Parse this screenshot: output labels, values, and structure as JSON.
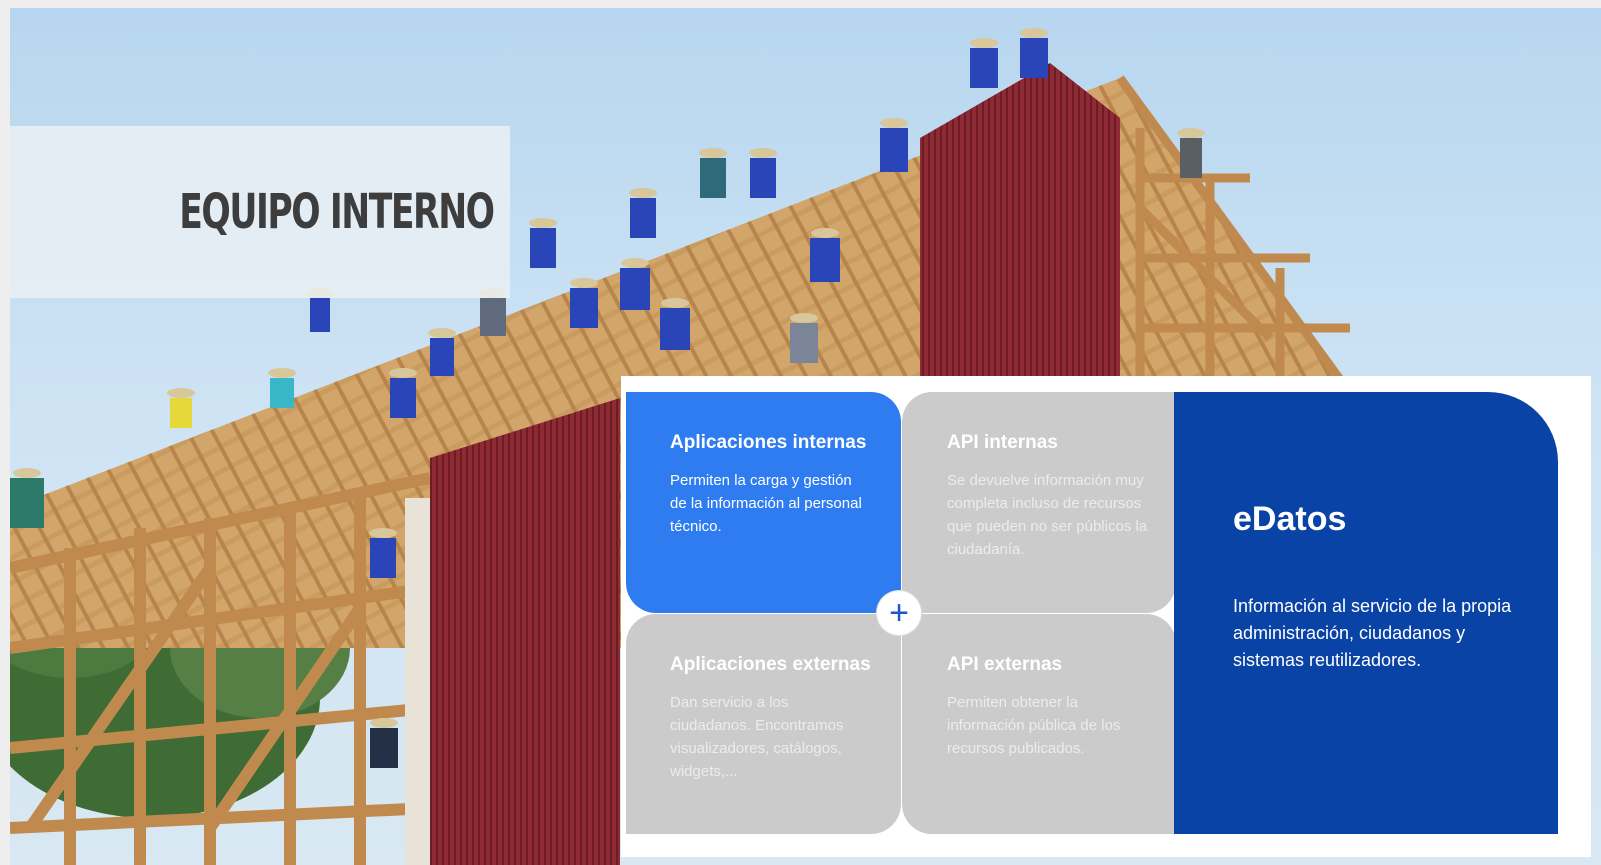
{
  "slide": {
    "title": "EQUIPO INTERNO",
    "photo_icon": "barn-raising-photo"
  },
  "cards": {
    "internal_apps": {
      "title": "Aplicaciones internas",
      "body": "Permiten la carga y gestión de la información al personal técnico."
    },
    "internal_api": {
      "title": "API internas",
      "body": "Se devuelve información muy completa incluso de recursos que pueden no ser públicos la ciudadanía."
    },
    "external_apps": {
      "title": "Aplicaciones externas",
      "body": "Dan servicio a los ciudadanos. Encontramos visualizadores, catálogos, widgets,..."
    },
    "external_api": {
      "title": "API externas",
      "body": "Permiten obtener la información pública de los recursos publicados."
    }
  },
  "edatos": {
    "title": "eDatos",
    "body": "Información al servicio de la propia administración, ciudadanos y sistemas reutilizadores."
  },
  "plus_icon": "plus-icon",
  "colors": {
    "blue": "#2e7cf0",
    "dark_blue": "#0a43a6",
    "grey": "#cbcbcb",
    "barn_red": "#8e2a33",
    "wood": "#c99a5e"
  }
}
